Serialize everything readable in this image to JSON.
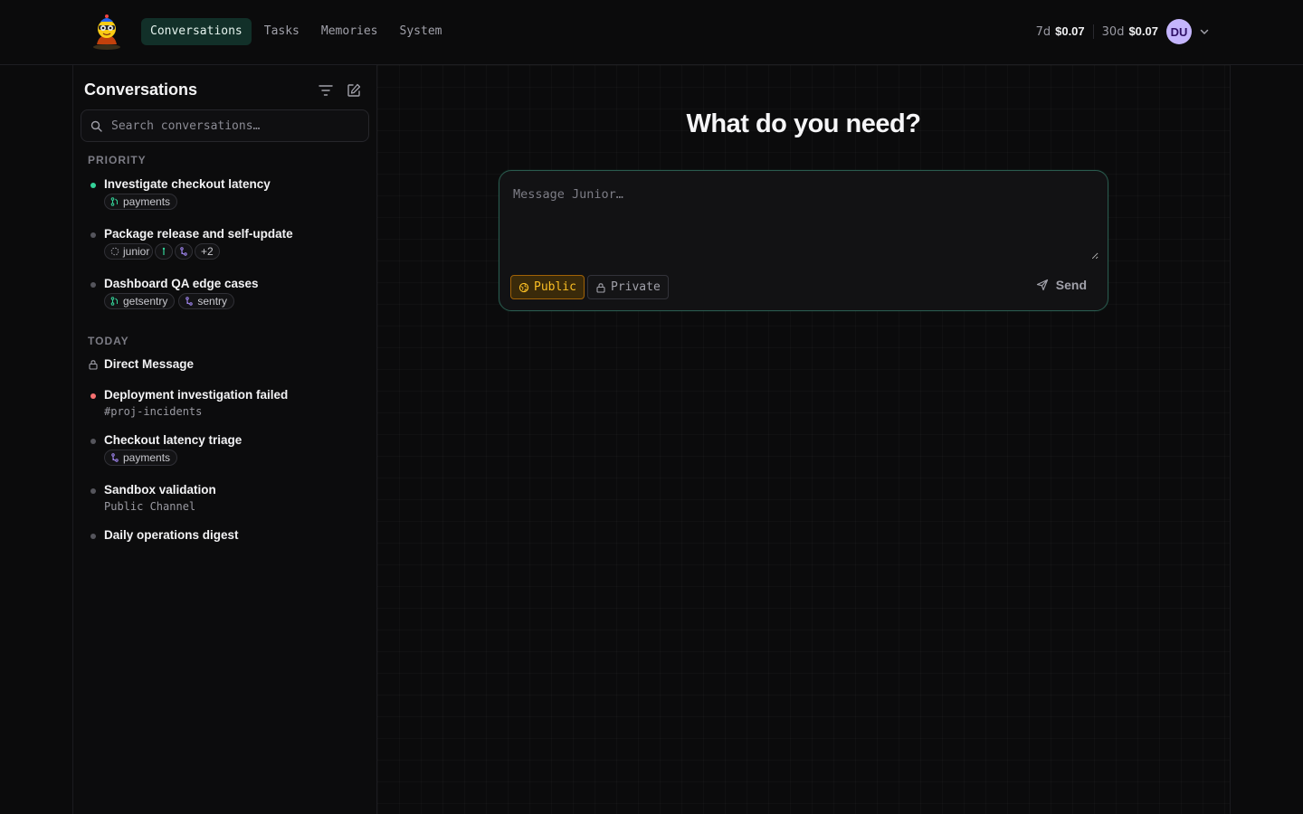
{
  "header": {
    "nav": [
      {
        "label": "Conversations",
        "active": true
      },
      {
        "label": "Tasks",
        "active": false
      },
      {
        "label": "Memories",
        "active": false
      },
      {
        "label": "System",
        "active": false
      }
    ],
    "usage": [
      {
        "label": "7d",
        "value": "$0.07"
      },
      {
        "label": "30d",
        "value": "$0.07"
      }
    ],
    "avatar": {
      "initials": "DU",
      "color": "#c4b5fd"
    }
  },
  "sidebar": {
    "title": "Conversations",
    "search_placeholder": "Search conversations…",
    "sections": [
      {
        "label": "PRIORITY",
        "items": [
          {
            "title": "Investigate checkout latency",
            "status": "green",
            "tags": [
              "payments"
            ]
          },
          {
            "title": "Package release and self-update",
            "status": "gray",
            "tags": [
              "junior",
              "+2"
            ]
          },
          {
            "title": "Dashboard QA edge cases",
            "status": "gray",
            "tags": [
              "getsentry",
              "sentry"
            ]
          }
        ]
      },
      {
        "label": "TODAY",
        "items": [
          {
            "title": "Direct Message",
            "status": "lock"
          },
          {
            "title": "Deployment investigation failed",
            "status": "red",
            "subtitle": "#proj-incidents"
          },
          {
            "title": "Checkout latency triage",
            "status": "gray",
            "tags": [
              "payments"
            ]
          },
          {
            "title": "Sandbox validation",
            "status": "gray",
            "subtitle": "Public Channel"
          },
          {
            "title": "Daily operations digest",
            "status": "gray"
          }
        ]
      }
    ]
  },
  "main": {
    "heading": "What do you need?",
    "composer": {
      "placeholder": "Message Junior…",
      "public_label": "Public",
      "private_label": "Private",
      "send_label": "Send"
    }
  },
  "colors": {
    "accent": "#34d399",
    "public": "#fbbf24",
    "danger": "#f87171",
    "background": "#0b0b0c"
  }
}
